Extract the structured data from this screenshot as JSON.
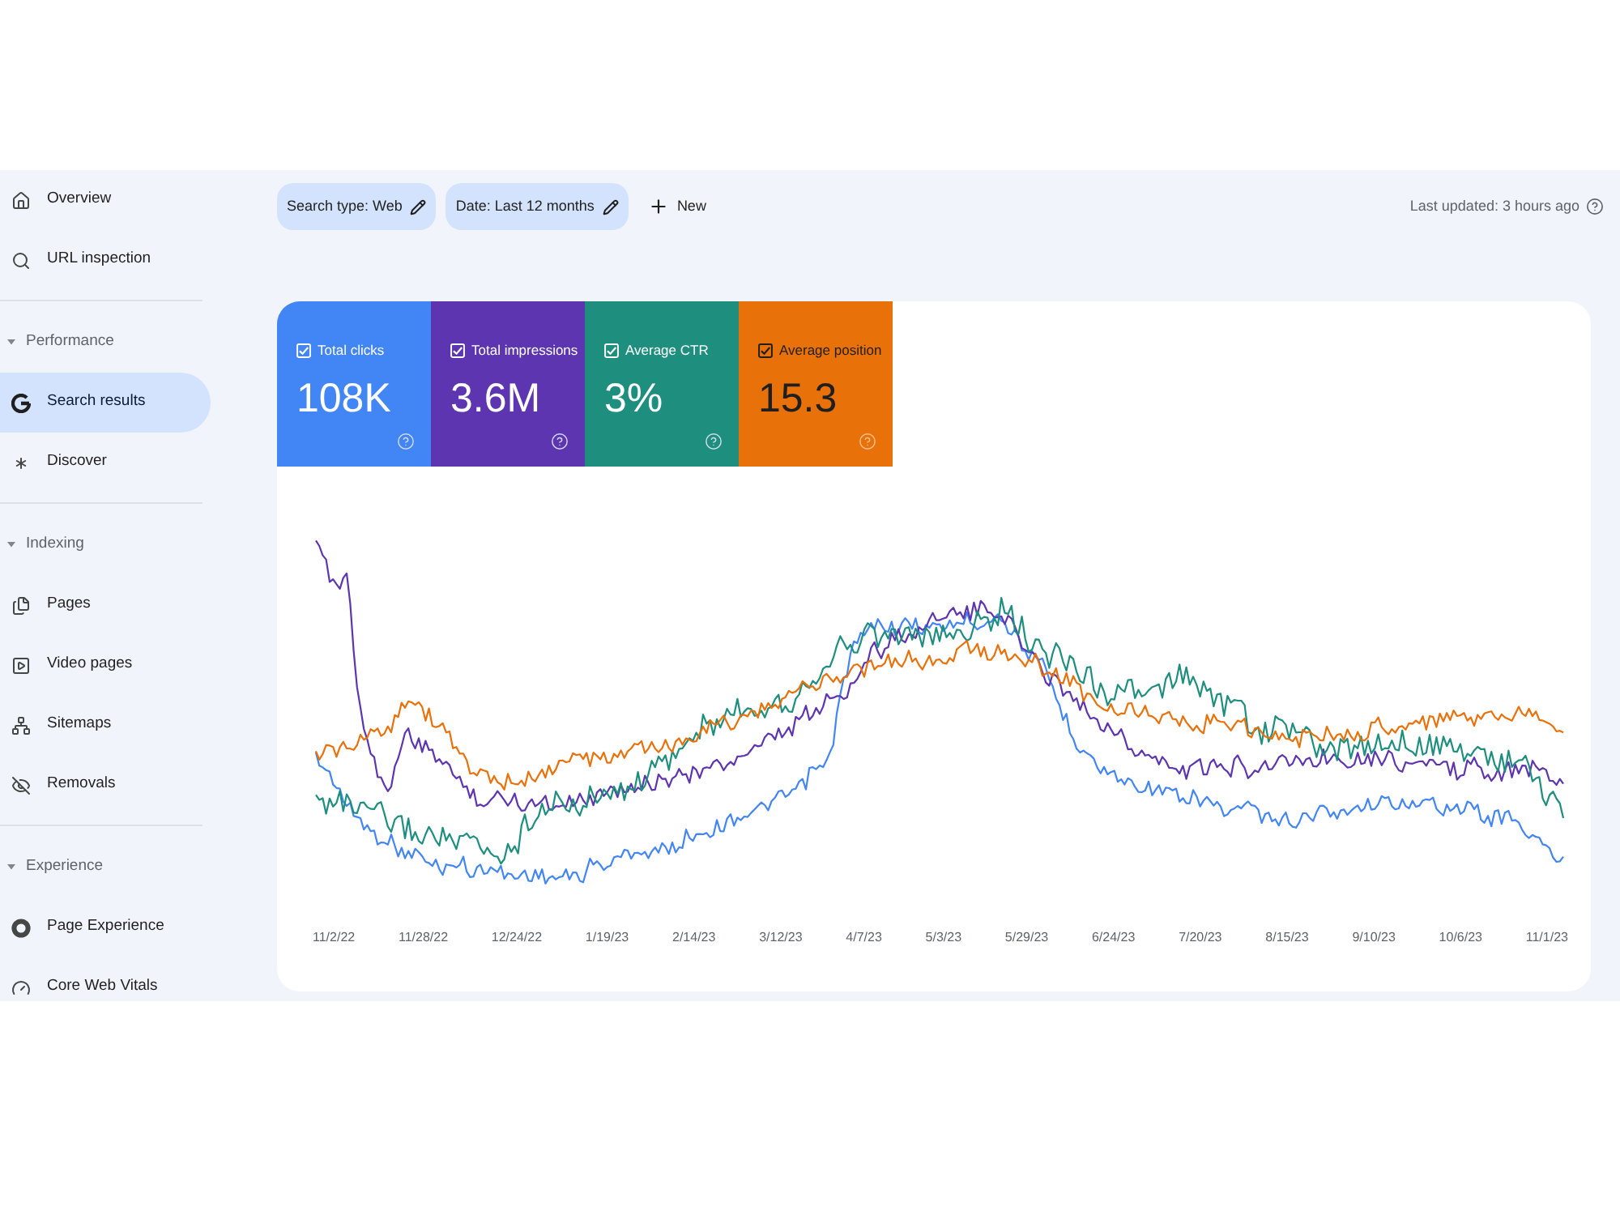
{
  "sidebar": {
    "top_items": [
      {
        "label": "Overview",
        "selected": false
      },
      {
        "label": "URL inspection",
        "selected": false
      }
    ],
    "sections": [
      {
        "title": "Performance",
        "expanded": true,
        "items": [
          {
            "label": "Search results",
            "selected": true
          },
          {
            "label": "Discover",
            "selected": false
          }
        ]
      },
      {
        "title": "Indexing",
        "expanded": true,
        "items": [
          {
            "label": "Pages",
            "selected": false
          },
          {
            "label": "Video pages",
            "selected": false
          },
          {
            "label": "Sitemaps",
            "selected": false
          },
          {
            "label": "Removals",
            "selected": false
          }
        ]
      },
      {
        "title": "Experience",
        "expanded": true,
        "items": [
          {
            "label": "Page Experience",
            "selected": false
          },
          {
            "label": "Core Web Vitals",
            "selected": false
          }
        ]
      }
    ]
  },
  "toolbar": {
    "filters": [
      {
        "label": "Search type: Web"
      },
      {
        "label": "Date: Last 12 months"
      }
    ],
    "new_button": "New",
    "last_updated": "Last updated: 3 hours ago"
  },
  "metrics": [
    {
      "label": "Total clicks",
      "value": "108K",
      "checked": true,
      "color": "#4285f4"
    },
    {
      "label": "Total impressions",
      "value": "3.6M",
      "checked": true,
      "color": "#5e35b1"
    },
    {
      "label": "Average CTR",
      "value": "3%",
      "checked": true,
      "color": "#1e8e7e"
    },
    {
      "label": "Average position",
      "value": "15.3",
      "checked": true,
      "color": "#e8710a"
    }
  ],
  "chart": {
    "x_labels": [
      "11/2/22",
      "11/28/22",
      "12/24/22",
      "1/19/23",
      "2/14/23",
      "3/12/23",
      "4/7/23",
      "5/3/23",
      "5/29/23",
      "6/24/23",
      "7/20/23",
      "8/15/23",
      "9/10/23",
      "10/6/23",
      "11/1/23"
    ]
  }
}
